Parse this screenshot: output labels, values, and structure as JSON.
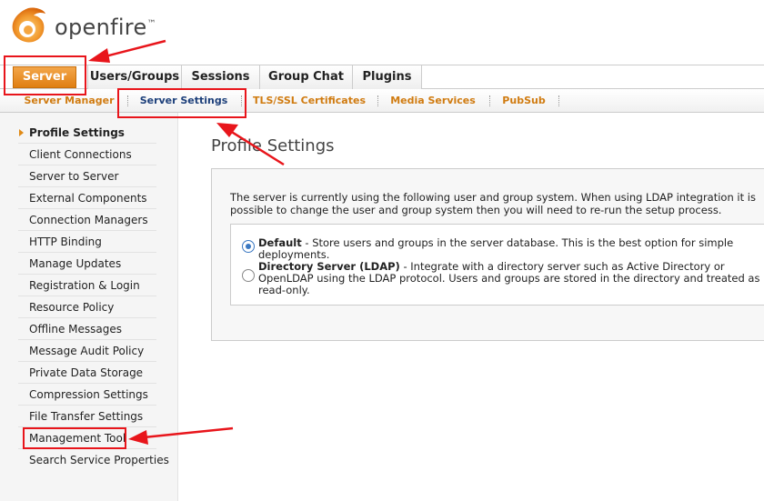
{
  "brand": {
    "name": "openfire",
    "trademark": "™",
    "accent": "#e07f12"
  },
  "main_tabs": [
    {
      "label": "Server",
      "active": true
    },
    {
      "label": "Users/Groups",
      "active": false
    },
    {
      "label": "Sessions",
      "active": false
    },
    {
      "label": "Group Chat",
      "active": false
    },
    {
      "label": "Plugins",
      "active": false
    }
  ],
  "sub_tabs": [
    {
      "label": "Server Manager",
      "active": false
    },
    {
      "label": "Server Settings",
      "active": true
    },
    {
      "label": "TLS/SSL Certificates",
      "active": false
    },
    {
      "label": "Media Services",
      "active": false
    },
    {
      "label": "PubSub",
      "active": false
    }
  ],
  "sidebar": {
    "items": [
      {
        "label": "Profile Settings",
        "active": true
      },
      {
        "label": "Client Connections"
      },
      {
        "label": "Server to Server"
      },
      {
        "label": "External Components"
      },
      {
        "label": "Connection Managers"
      },
      {
        "label": "HTTP Binding"
      },
      {
        "label": "Manage Updates"
      },
      {
        "label": "Registration & Login"
      },
      {
        "label": "Resource Policy"
      },
      {
        "label": "Offline Messages"
      },
      {
        "label": "Message Audit Policy"
      },
      {
        "label": "Private Data Storage"
      },
      {
        "label": "Compression Settings"
      },
      {
        "label": "File Transfer Settings"
      },
      {
        "label": "Management Tool"
      },
      {
        "label": "Search Service Properties"
      }
    ]
  },
  "content": {
    "title": "Profile Settings",
    "description": "The server is currently using the following user and group system. When using LDAP integration it is possible to change the user and group system then you will need to re-run the setup process.",
    "options": [
      {
        "name": "Default",
        "text": " - Store users and groups in the server database. This is the best option for simple deployments.",
        "checked": true
      },
      {
        "name": "Directory Server (LDAP)",
        "text": " - Integrate with a directory server such as Active Directory or OpenLDAP using the LDAP protocol. Users and groups are stored in the directory and treated as read-only.",
        "checked": false
      }
    ]
  },
  "annotation_color": "#e8151b"
}
